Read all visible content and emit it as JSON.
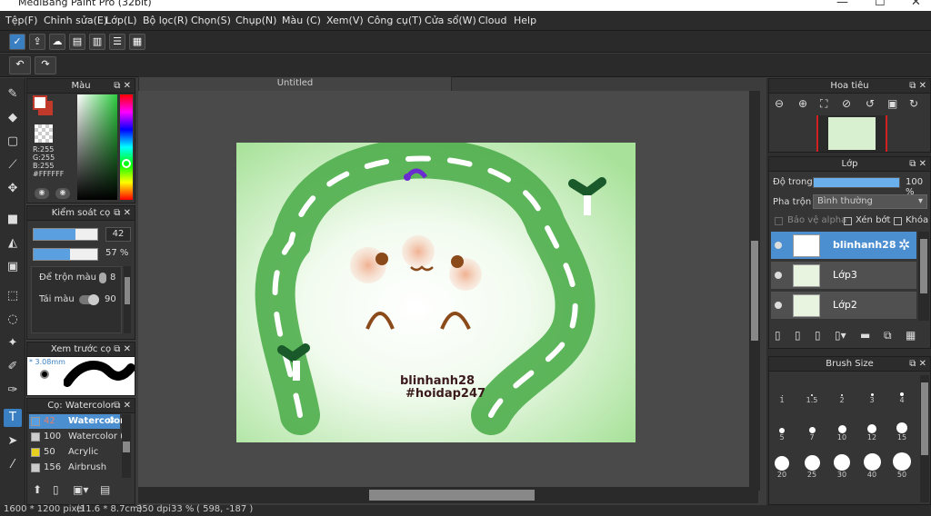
{
  "window": {
    "title": "MediBang Paint Pro (32bit)",
    "min": "—",
    "max": "☐",
    "close": "✕"
  },
  "menu": [
    "Tệp(F)",
    "Chỉnh sửa(E)",
    "Lớp(L)",
    "Bộ lọc(R)",
    "Chọn(S)",
    "Chụp(N)",
    "Màu (C)",
    "Xem(V)",
    "Công cụ(T)",
    "Cửa sổ(W)",
    "Cloud",
    "Help"
  ],
  "color_panel": {
    "title": "Màu",
    "r": "R:255",
    "g": "G:255",
    "b": "B:255",
    "hex": "#FFFFFF",
    "primary": "#ffffff",
    "secondary": "#c0392b"
  },
  "brush_control": {
    "title": "Kiểm soát cọ",
    "size": "42",
    "size_fill": 0.65,
    "opacity": "57 %",
    "opacity_fill": 0.57,
    "mix_label": "Để trộn màu",
    "mix_value": "8",
    "refill_label": "Tái màu",
    "refill_value": "90"
  },
  "preview": {
    "title": "Xem trước cọ",
    "size": "* 3.08mm"
  },
  "brush_list": {
    "title": "Cọ: Watercolor",
    "items": [
      {
        "n": "42",
        "name": "Watercolor",
        "color": "#5aa0e0",
        "selected": true
      },
      {
        "n": "100",
        "name": "Watercolor (",
        "color": "#cccccc",
        "selected": false
      },
      {
        "n": "50",
        "name": "Acrylic",
        "color": "#e8d020",
        "selected": false
      },
      {
        "n": "156",
        "name": "Airbrush",
        "color": "#cccccc",
        "selected": false
      }
    ]
  },
  "document": {
    "tab": "Untitled",
    "art_line1": "blinhanh28",
    "art_line2": "#hoidap247"
  },
  "navigator": {
    "title": "Hoa tiêu"
  },
  "layers": {
    "title": "Lớp",
    "opacity_label": "Độ trong",
    "opacity_value": "100 %",
    "blend_label": "Pha trộn",
    "blend_value": "Bình thường",
    "protect_alpha": "Bảo vệ alpha",
    "clip": "Xén bớt",
    "lock": "Khóa",
    "items": [
      {
        "name": "blinhanh28",
        "selected": true
      },
      {
        "name": "Lớp3",
        "selected": false
      },
      {
        "name": "Lớp2",
        "selected": false
      }
    ]
  },
  "brush_size": {
    "title": "Brush Size",
    "sizes": [
      "1",
      "1.5",
      "2",
      "3",
      "4",
      "5",
      "7",
      "10",
      "12",
      "15",
      "20",
      "25",
      "30",
      "40",
      "50"
    ]
  },
  "status": {
    "dims": "1600 * 1200 pixel",
    "cm": "(11.6 * 8.7cm)",
    "dpi": "350 dpi",
    "zoom": "33 %",
    "coords": "( 598, -187 )"
  },
  "icons": [
    "undo-icon",
    "redo-icon",
    "brush-icon",
    "eraser-icon",
    "gear-icon",
    "eye-icon",
    "close-icon"
  ]
}
